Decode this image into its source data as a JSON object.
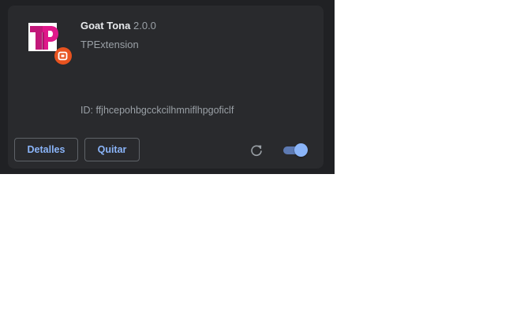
{
  "extension": {
    "name": "Goat Tona",
    "version": "2.0.0",
    "description": "TPExtension",
    "id_text": "ID: ffjhcepohbgcckcilhmniflhpgoficlf",
    "icon": "tp-logo-icon",
    "badge_icon": "record-badge-icon",
    "enabled": true
  },
  "actions": {
    "details_label": "Detalles",
    "remove_label": "Quitar",
    "reload_icon": "reload-icon",
    "toggle_state": "on"
  },
  "colors": {
    "page_bg": "#202124",
    "card_bg": "#292a2d",
    "accent": "#8ab4f8",
    "logo_magenta": "#e0188a",
    "badge_orange": "#e8531f"
  }
}
